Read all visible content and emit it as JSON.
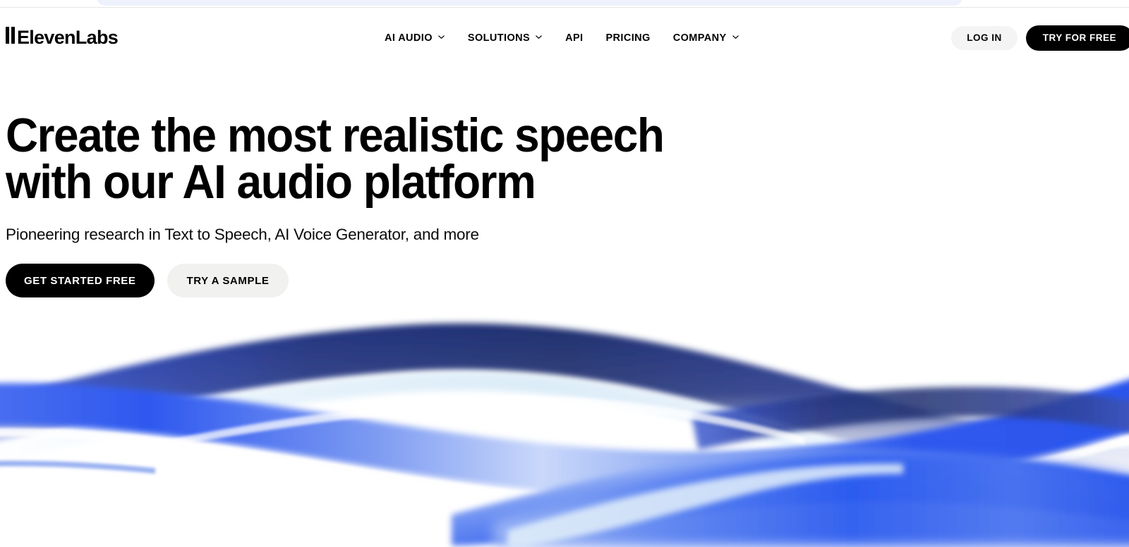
{
  "site": {
    "brand_name": "ElevenLabs",
    "logo_mark": "two-bars"
  },
  "promo": {
    "visible_remnant": true,
    "background_color": "#eef2fd"
  },
  "header": {
    "nav": [
      {
        "label": "AI AUDIO",
        "has_dropdown": true,
        "icon": "chevron-down-icon"
      },
      {
        "label": "SOLUTIONS",
        "has_dropdown": true,
        "icon": "chevron-down-icon"
      },
      {
        "label": "API",
        "has_dropdown": false
      },
      {
        "label": "PRICING",
        "has_dropdown": false
      },
      {
        "label": "COMPANY",
        "has_dropdown": true,
        "icon": "chevron-down-icon"
      }
    ],
    "login_label": "LOG IN",
    "try_free_label": "TRY FOR FREE"
  },
  "hero": {
    "title": "Create the most realistic speech\nwith our AI audio platform",
    "title_line_1": "Create the most realistic speech",
    "title_line_2": "with our AI audio platform",
    "subtitle": "Pioneering research in Text to Speech, AI Voice Generator, and more",
    "primary_cta": "GET STARTED FREE",
    "secondary_cta": "TRY A SAMPLE"
  },
  "colors": {
    "text": "#000000",
    "page_background": "#ffffff",
    "button_dark": "#000000",
    "button_light": "#f4f4f5",
    "button_light_alt": "#f1f1f0",
    "divider": "#e6e6e6",
    "promo_band": "#eef2fd",
    "wave_vivid_blue": "#2b5bef",
    "wave_navy": "#1b2a80",
    "wave_mid_blue": "#6b8fef",
    "wave_pale": "#eaf4fb"
  },
  "artwork": {
    "name": "audio-wave-graphic",
    "description": "Flowing blue ribbon wave illustration"
  }
}
